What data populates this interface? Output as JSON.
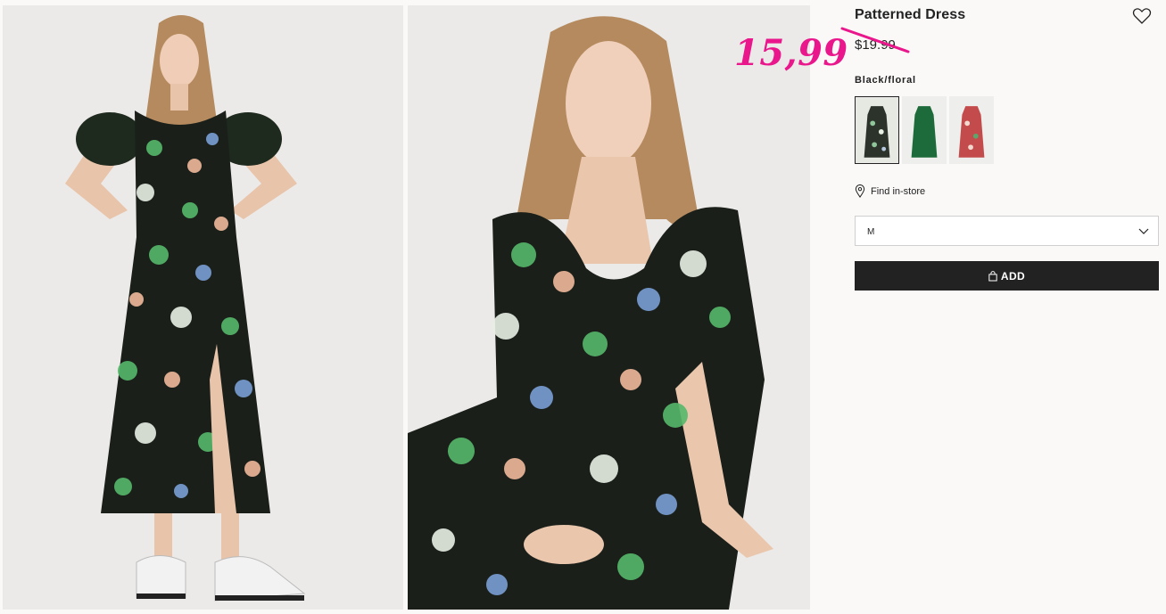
{
  "product": {
    "title": "Patterned Dress",
    "old_price": "$19.99",
    "sale_price": "15,99",
    "color_label": "Black/floral",
    "swatches": [
      {
        "color": "#d8ddd4",
        "pattern": "black-floral",
        "selected": true
      },
      {
        "color": "#1d6b3a",
        "pattern": "green",
        "selected": false
      },
      {
        "color": "#c44b4b",
        "pattern": "red-floral",
        "selected": false
      }
    ],
    "find_in_store": "Find in-store",
    "size_value": "M",
    "add_label": "ADD"
  },
  "colors": {
    "sale_accent": "#ea178c",
    "button_bg": "#222222",
    "background": "#faf9f8"
  },
  "icons": {
    "favorite": "heart-icon",
    "store": "location-pin-icon",
    "size": "chevron-down-icon",
    "add": "shopping-bag-icon"
  }
}
